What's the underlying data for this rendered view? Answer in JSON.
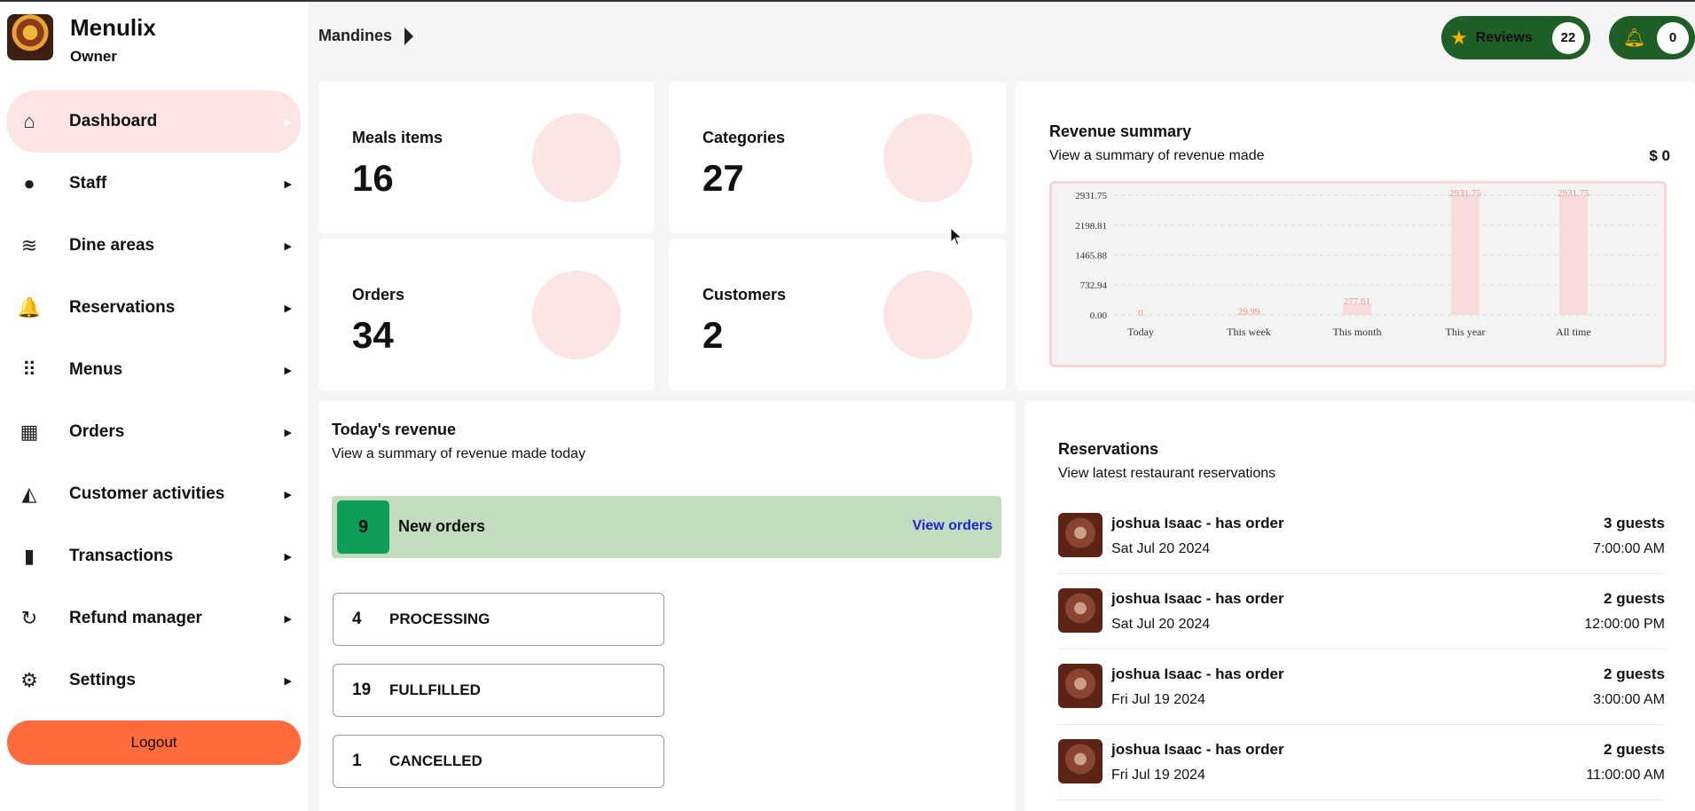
{
  "app": {
    "name": "Menulix",
    "role": "Owner"
  },
  "sidebar": {
    "items": [
      {
        "label": "Dashboard",
        "icon": "home-icon",
        "glyph": "⌂",
        "active": true
      },
      {
        "label": "Staff",
        "icon": "user-icon",
        "glyph": "●"
      },
      {
        "label": "Dine areas",
        "icon": "database-icon",
        "glyph": "≋"
      },
      {
        "label": "Reservations",
        "icon": "bell-icon",
        "glyph": "🔔"
      },
      {
        "label": "Menus",
        "icon": "grid-icon",
        "glyph": "⠿"
      },
      {
        "label": "Orders",
        "icon": "store-icon",
        "glyph": "▦"
      },
      {
        "label": "Customer activities",
        "icon": "area-chart-icon",
        "glyph": "◭"
      },
      {
        "label": "Transactions",
        "icon": "battery-icon",
        "glyph": "▮"
      },
      {
        "label": "Refund manager",
        "icon": "refresh-icon",
        "glyph": "↻"
      },
      {
        "label": "Settings",
        "icon": "gear-icon",
        "glyph": "⚙"
      }
    ],
    "logout_label": "Logout"
  },
  "header": {
    "breadcrumb": "Mandines",
    "reviews_label": "Reviews",
    "reviews_count": "22",
    "notifications_count": "0"
  },
  "stats": {
    "meals": {
      "label": "Meals items",
      "value": "16"
    },
    "categories": {
      "label": "Categories",
      "value": "27"
    },
    "orders": {
      "label": "Orders",
      "value": "34"
    },
    "customers": {
      "label": "Customers",
      "value": "2"
    }
  },
  "revenue_summary": {
    "title": "Revenue summary",
    "subtitle": "View a summary of revenue made",
    "total": "$ 0"
  },
  "chart_data": {
    "type": "bar",
    "categories": [
      "Today",
      "This week",
      "This month",
      "This year",
      "All time"
    ],
    "values": [
      0,
      29.99,
      277.61,
      2931.75,
      2931.75
    ],
    "value_labels": [
      "0",
      "29.99",
      "277.61",
      "2931.75",
      "2931.75"
    ],
    "yticks": [
      "0.00",
      "732.94",
      "1465.88",
      "2198.81",
      "2931.75"
    ],
    "ylim": [
      0,
      2931.75
    ],
    "grid": true,
    "bar_color": "#f7dada",
    "label_color": "#f08f7e"
  },
  "today_revenue": {
    "title": "Today's revenue",
    "subtitle": "View a summary of revenue made today",
    "new_orders_count": "9",
    "new_orders_label": "New orders",
    "view_orders_label": "View orders",
    "statuses": [
      {
        "count": "4",
        "label": "PROCESSING"
      },
      {
        "count": "19",
        "label": "FULLFILLED"
      },
      {
        "count": "1",
        "label": "CANCELLED"
      }
    ]
  },
  "reservations": {
    "title": "Reservations",
    "subtitle": "View latest restaurant reservations",
    "items": [
      {
        "name": "joshua Isaac - has order",
        "date": "Sat Jul 20 2024",
        "guests": "3 guests",
        "time": "7:00:00 AM"
      },
      {
        "name": "joshua Isaac - has order",
        "date": "Sat Jul 20 2024",
        "guests": "2 guests",
        "time": "12:00:00 PM"
      },
      {
        "name": "joshua Isaac - has order",
        "date": "Fri Jul 19 2024",
        "guests": "2 guests",
        "time": "3:00:00 AM"
      },
      {
        "name": "joshua Isaac - has order",
        "date": "Fri Jul 19 2024",
        "guests": "2 guests",
        "time": "11:00:00 AM"
      }
    ]
  },
  "colors": {
    "accent": "#ff6b3d",
    "active_nav_bg": "#fde4e4",
    "pill_bg": "#1f5f27",
    "new_orders_bg": "#c3dbbf",
    "new_orders_badge": "#0f9d58"
  }
}
